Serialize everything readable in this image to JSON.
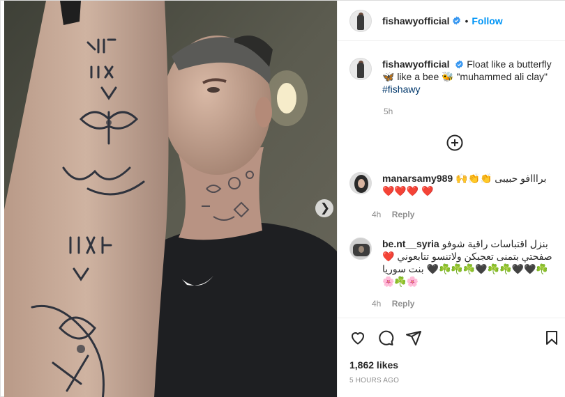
{
  "post": {
    "username": "fishawyofficial",
    "follow_label": "Follow",
    "separator": "•",
    "caption_text": "Float like a butterfly 🦋 like a bee 🐝 \"muhammed ali clay\"",
    "caption_tag": "#fishawy",
    "caption_time": "5h"
  },
  "comments": [
    {
      "username": "manarsamy989",
      "text": "برااافو حبيبى 👏👏🙌❤️ ❤️❤️❤️",
      "time": "4h",
      "reply_label": "Reply"
    },
    {
      "username": "be.nt__syria",
      "text": "بنزل اقتباسات راقية شوفو صفحتي بتمنى تعجبكن ولاتنسو تتابعوني ❤️ ☘️🖤🖤☘️☘️🖤☘️☘️☘️🖤 بنت سوريا 🌸☘️🌸",
      "time": "4h",
      "reply_label": "Reply"
    }
  ],
  "actions": {
    "likes": "1,862 likes",
    "time_ago": "5 HOURS AGO"
  },
  "icons": {
    "next": "chevron-right-icon",
    "verified": "verified-badge-icon",
    "load_more": "plus-circle-icon",
    "like": "heart-icon",
    "comment": "comment-icon",
    "share": "share-icon",
    "save": "bookmark-icon"
  },
  "colors": {
    "accent": "#0095f6",
    "verified": "#3897f0",
    "muted": "#8e8e8e"
  }
}
